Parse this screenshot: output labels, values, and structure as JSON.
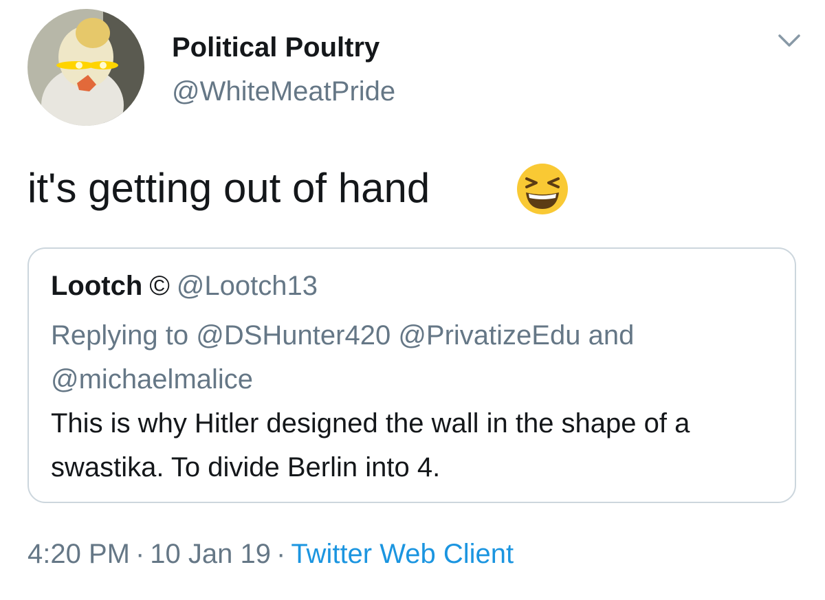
{
  "author": {
    "display_name": "Political Poultry",
    "handle": "@WhiteMeatPride",
    "avatar": "glowing-eyed-chicken-avatar"
  },
  "tweet": {
    "text": "it's getting out of hand",
    "emoji": "grinning-squinting-face-emoji"
  },
  "quoted_tweet": {
    "display_name": "Lootch",
    "badge": "©",
    "handle": "@Lootch13",
    "reply_context": "Replying to @DSHunter420 @PrivatizeEdu and @michaelmalice",
    "text": "This is why Hitler designed the wall in the shape of a swastika. To divide Berlin into 4."
  },
  "meta": {
    "time": "4:20 PM",
    "separator": "·",
    "date": "10 Jan 19",
    "client": "Twitter Web Client"
  },
  "colors": {
    "primary_text": "#14171a",
    "secondary_text": "#657786",
    "link": "#1b95e0",
    "border": "#ccd6dd"
  }
}
